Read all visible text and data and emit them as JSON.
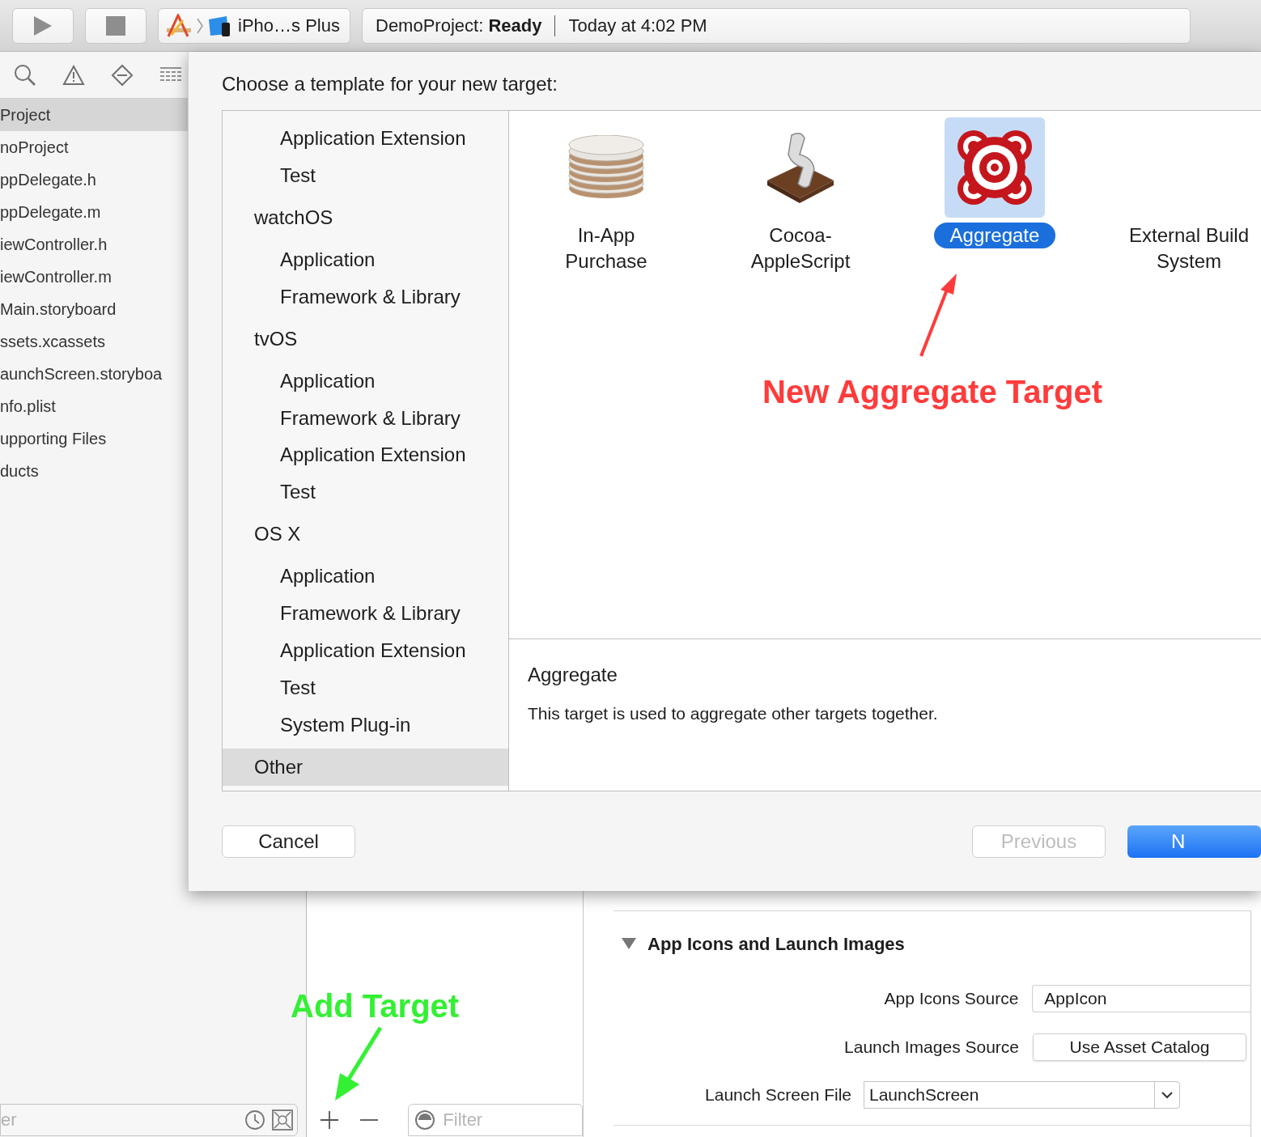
{
  "toolbar": {
    "scheme": {
      "device": "iPho…s Plus"
    },
    "status": {
      "text": "DemoProject: **Ready**",
      "time": "Today at 4:02 PM"
    }
  },
  "navigator": {
    "items": [
      {
        "label": "Project",
        "selected": true
      },
      {
        "label": "noProject",
        "selected": false
      },
      {
        "label": "ppDelegate.h",
        "selected": false
      },
      {
        "label": "ppDelegate.m",
        "selected": false
      },
      {
        "label": "iewController.h",
        "selected": false
      },
      {
        "label": "iewController.m",
        "selected": false
      },
      {
        "label": "Main.storyboard",
        "selected": false
      },
      {
        "label": "ssets.xcassets",
        "selected": false
      },
      {
        "label": "aunchScreen.storyboa",
        "selected": false
      },
      {
        "label": "nfo.plist",
        "selected": false
      },
      {
        "label": "upporting Files",
        "selected": false
      },
      {
        "label": "ducts",
        "selected": false
      }
    ],
    "filter": {
      "placeholder": "er"
    }
  },
  "targets_panel": {
    "filter": {
      "placeholder": "Filter"
    }
  },
  "settings": {
    "section": {
      "title": "App Icons and Launch Images",
      "expanded": true
    },
    "rows": [
      {
        "label": "App Icons Source",
        "kind": "field",
        "value": "AppIcon"
      },
      {
        "label": "Launch Images Source",
        "kind": "button",
        "value": "Use Asset Catalog"
      },
      {
        "label": "Launch Screen File",
        "kind": "combo",
        "value": "LaunchScreen"
      }
    ]
  },
  "dialog": {
    "title": "Choose a template for your new target:",
    "categories": [
      {
        "kind": "item",
        "label": "Application Extension",
        "selected": false
      },
      {
        "kind": "item",
        "label": "Test",
        "selected": false
      },
      {
        "kind": "header",
        "label": "watchOS",
        "selected": false
      },
      {
        "kind": "item",
        "label": "Application",
        "selected": false
      },
      {
        "kind": "item",
        "label": "Framework & Library",
        "selected": false
      },
      {
        "kind": "header",
        "label": "tvOS",
        "selected": false
      },
      {
        "kind": "item",
        "label": "Application",
        "selected": false
      },
      {
        "kind": "item",
        "label": "Framework & Library",
        "selected": false
      },
      {
        "kind": "item",
        "label": "Application Extension",
        "selected": false
      },
      {
        "kind": "item",
        "label": "Test",
        "selected": false
      },
      {
        "kind": "header",
        "label": "OS X",
        "selected": false
      },
      {
        "kind": "item",
        "label": "Application",
        "selected": false
      },
      {
        "kind": "item",
        "label": "Framework & Library",
        "selected": false
      },
      {
        "kind": "item",
        "label": "Application Extension",
        "selected": false
      },
      {
        "kind": "item",
        "label": "Test",
        "selected": false
      },
      {
        "kind": "item",
        "label": "System Plug-in",
        "selected": false
      },
      {
        "kind": "header",
        "label": "Other",
        "selected": true
      }
    ],
    "templates": [
      {
        "kind": "coins",
        "label": "In-App\nPurchase",
        "selected": false
      },
      {
        "kind": "script",
        "label": "Cocoa-\nAppleScript",
        "selected": false
      },
      {
        "kind": "target",
        "label": "Aggregate",
        "selected": true
      },
      {
        "kind": "blank",
        "label": "External Build\nSystem",
        "selected": false
      }
    ],
    "description": {
      "title": "Aggregate",
      "text": "This target is used to aggregate other targets together."
    },
    "buttons": [
      {
        "kind": "normal",
        "label": "Cancel",
        "disabled": false
      },
      {
        "kind": "normal",
        "label": "Previous",
        "disabled": true
      },
      {
        "kind": "default",
        "label": "N",
        "disabled": false
      }
    ]
  },
  "annotations": [
    {
      "kind": "template",
      "text": "New Aggregate Target",
      "color": "#ff3b3b"
    },
    {
      "kind": "add",
      "text": "Add Target",
      "color": "#33f033"
    }
  ]
}
